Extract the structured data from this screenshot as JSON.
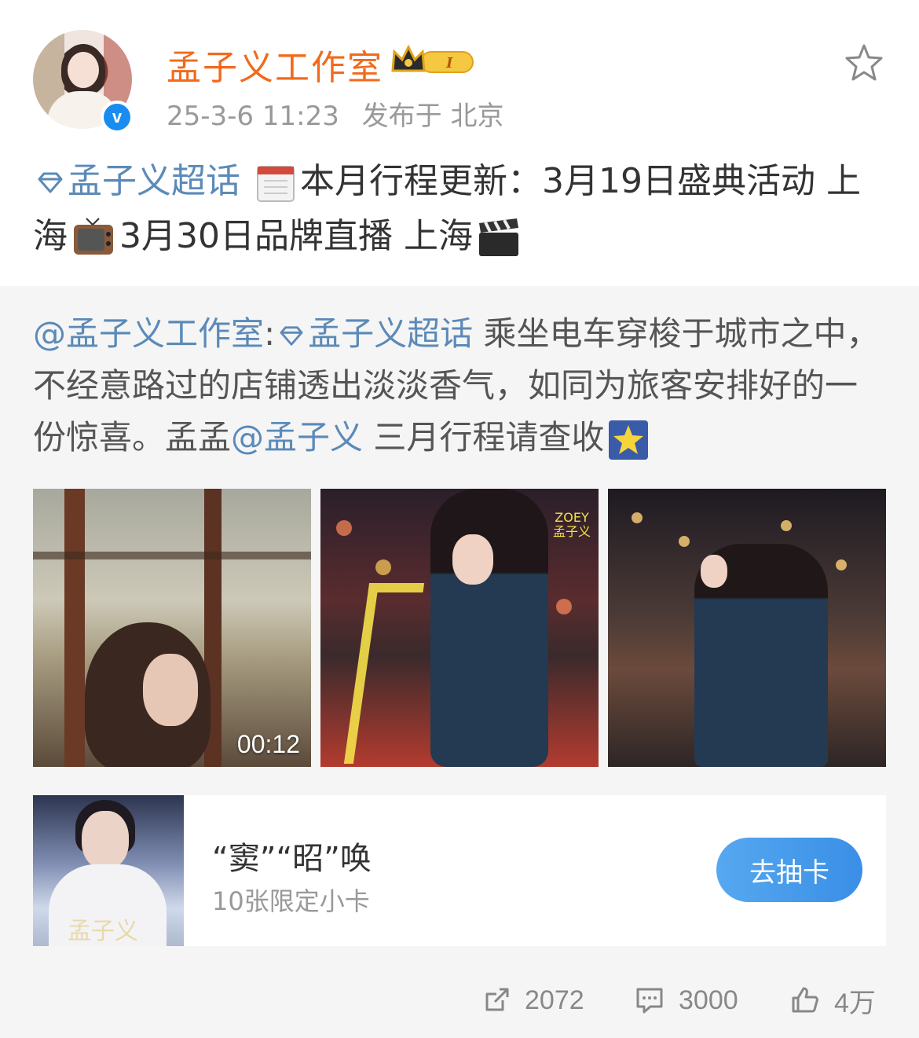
{
  "user": {
    "name": "孟子义工作室",
    "badge_level": "I",
    "verified_mark": "v",
    "date": "25-3-6 11:23",
    "location": "发布于 北京"
  },
  "post": {
    "topic": "孟子义超话",
    "text_1": "本月行程更新：3月19日盛典活动 上海",
    "text_2": "3月30日品牌直播 上海"
  },
  "repost": {
    "mention_author": "@孟子义工作室",
    "colon": ":",
    "topic": "孟子义超话",
    "text_1": "乘坐电车穿梭于城市之中，不经意路过的店铺透出淡淡香气，如同为旅客安排好的一份惊喜。孟孟",
    "mention_user": "@孟子义",
    "text_2": "三月行程请查收",
    "video_duration": "00:12",
    "image_2_caption_en": "ZOEY",
    "image_2_caption_cn": "孟子义"
  },
  "card": {
    "title": "“窦”“昭”唤",
    "subtitle": "10张限定小卡",
    "button": "去抽卡",
    "image_signature": "孟子义"
  },
  "actions": {
    "reposts": "2072",
    "comments": "3000",
    "likes": "4万"
  },
  "icons": [
    "star-icon",
    "crown-badge-icon",
    "verified-icon",
    "supertopic-diamond-icon",
    "calendar-emoji",
    "tv-emoji",
    "clapper-emoji",
    "star-emoji",
    "repost-icon",
    "comment-icon",
    "like-icon"
  ],
  "colors": {
    "username": "#f26a1b",
    "link": "#5b8ab8",
    "verified": "#1a8cf0",
    "repost_bg": "#f5f5f5",
    "button": "#3a8fe6"
  }
}
